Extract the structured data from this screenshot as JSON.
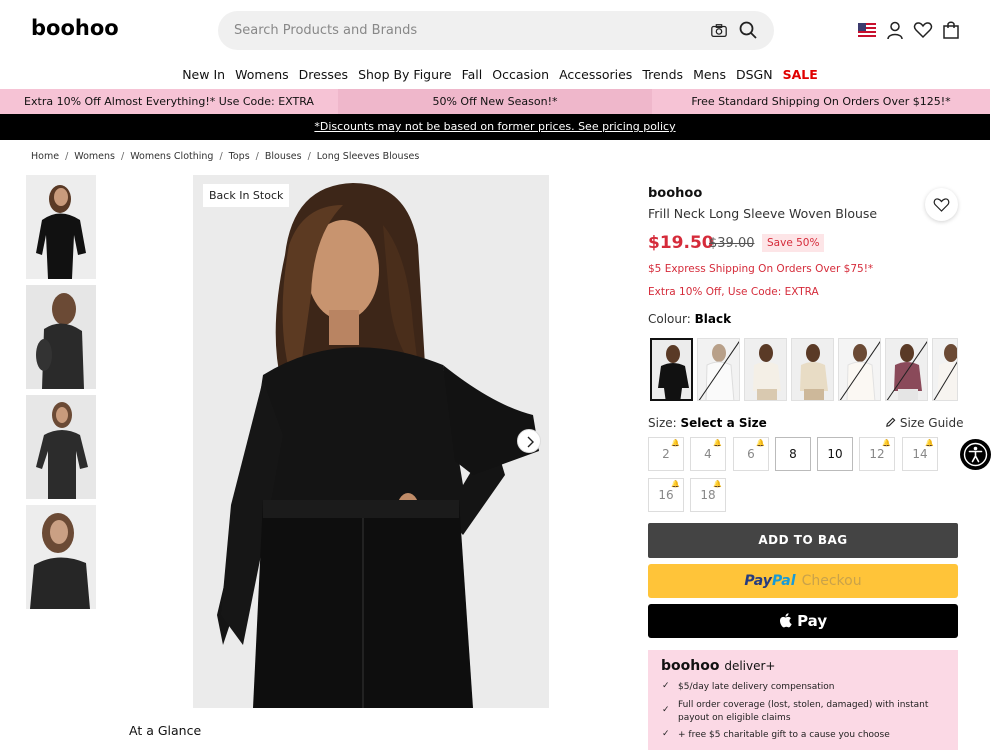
{
  "header": {
    "logo": "boohoo",
    "search_placeholder": "Search Products and Brands"
  },
  "nav": [
    "New In",
    "Womens",
    "Dresses",
    "Shop By Figure",
    "Fall",
    "Occasion",
    "Accessories",
    "Trends",
    "Mens",
    "DSGN"
  ],
  "nav_sale": "SALE",
  "promo": {
    "left": "Extra 10% Off Almost Everything!* Use Code: EXTRA",
    "center": "50% Off New Season!*",
    "right": "Free Standard Shipping On Orders Over $125!*"
  },
  "disclaimer": "*Discounts may not be based on former prices. See pricing policy",
  "breadcrumb": [
    "Home",
    "Womens",
    "Womens Clothing",
    "Tops",
    "Blouses",
    "Long Sleeves Blouses"
  ],
  "main_image": {
    "badge": "Back In Stock"
  },
  "at_a_glance": "At a Glance",
  "product": {
    "brand": "boohoo",
    "name": "Frill Neck Long Sleeve Woven Blouse",
    "price": "$19.50",
    "old_price": "$39.00",
    "save": "Save 50%",
    "shipping": "$5 Express Shipping On Orders Over $75!*",
    "extra": "Extra 10% Off, Use Code: EXTRA",
    "colour_label": "Colour:",
    "colour_value": "Black",
    "size_label": "Size:",
    "size_value": "Select a Size",
    "size_guide": "Size Guide",
    "sizes": [
      "2",
      "4",
      "6",
      "8",
      "10",
      "12",
      "14",
      "16",
      "18"
    ],
    "add_to_bag": "ADD TO BAG",
    "paypal_1": "Pay",
    "paypal_2": "Pal",
    "paypal_3": "Checkou",
    "apple_pay": "Pay"
  },
  "deliver": {
    "title": "boohoo",
    "title_suffix": "deliver+",
    "items": [
      "$5/day late delivery compensation",
      "Full order coverage (lost, stolen, damaged) with instant payout on eligible claims",
      "+ free $5 charitable gift to a cause you choose"
    ]
  },
  "colors": {
    "accent_red": "#d52b3a",
    "promo_pink": "#f6c3d5",
    "deliver_pink": "#fbd9e5",
    "paypal_yellow": "#ffc439"
  }
}
